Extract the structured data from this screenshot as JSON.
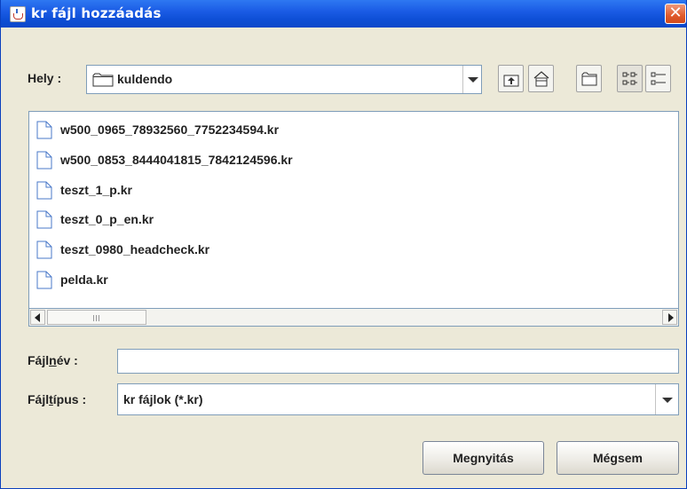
{
  "window": {
    "title": "kr fájl hozzáadás",
    "close_glyph": "✕"
  },
  "location": {
    "label": "Hely :",
    "value": "kuldendo"
  },
  "toolbar": {
    "buttons": [
      {
        "name": "up-one-level-icon"
      },
      {
        "name": "home-icon"
      },
      {
        "name": "new-folder-icon"
      },
      {
        "name": "list-view-icon",
        "selected": true
      },
      {
        "name": "details-view-icon"
      }
    ]
  },
  "files": [
    "w500_0965_78932560_7752234594.kr",
    "w500_0853_8444041815_7842124596.kr",
    "teszt_1_p.kr",
    "teszt_0_p_en.kr",
    "teszt_0980_headcheck.kr",
    "pelda.kr"
  ],
  "filename": {
    "label_pre": "Fájl",
    "label_mnemonic": "n",
    "label_post": "év :",
    "value": ""
  },
  "filetype": {
    "label_pre": "Fájl",
    "label_mnemonic": "t",
    "label_post": "ípus :",
    "value": "kr fájlok (*.kr)"
  },
  "actions": {
    "open_label": "Megnyitás",
    "cancel_label": "Mégsem"
  },
  "colors": {
    "titlebar": "#0e4fd6",
    "close": "#e05a2c",
    "dialog_bg": "#ece9d8",
    "field_border": "#7f9db9"
  }
}
